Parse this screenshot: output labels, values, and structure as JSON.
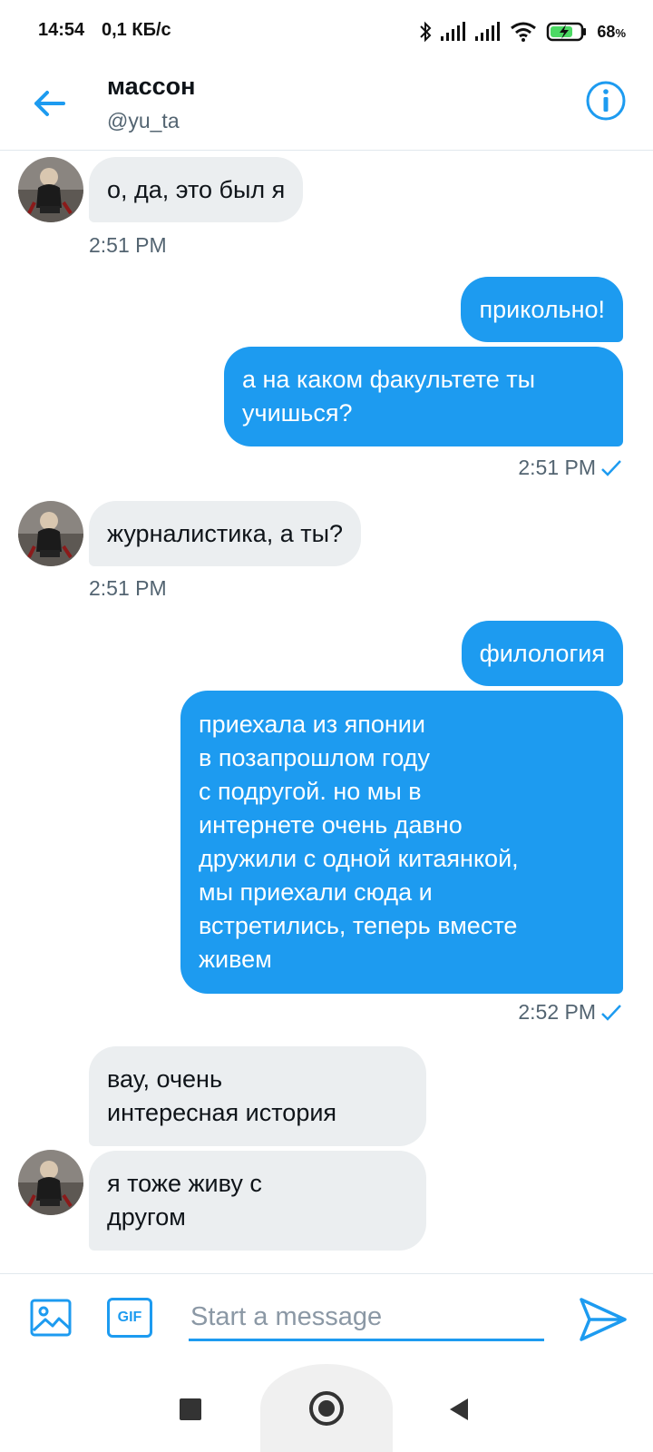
{
  "status_bar": {
    "time": "14:54",
    "speed": "0,1 КБ/с",
    "battery": "68",
    "battery_unit": "%",
    "icons": [
      "bluetooth-icon",
      "signal-icon",
      "signal-icon",
      "wifi-icon",
      "battery-charging-icon"
    ]
  },
  "header": {
    "title": "массон",
    "handle": "@yu_ta"
  },
  "messages": [
    {
      "direction": "received",
      "text": "о, да, это был я",
      "time": "2:51 PM"
    },
    {
      "direction": "sent",
      "text": "прикольно!"
    },
    {
      "direction": "sent",
      "text": "а на каком факультете ты\nучишься?",
      "time": "2:51 PM"
    },
    {
      "direction": "received",
      "text": "журналистика, а ты?",
      "time": "2:51 PM"
    },
    {
      "direction": "sent",
      "text": "филология"
    },
    {
      "direction": "sent",
      "text": "приехала из японии\nв позапрошлом году\nс подругой. но мы в\nинтернете очень давно\nдружили с одной китаянкой,\nмы приехали сюда и\nвстретились, теперь вместе\nживем",
      "time": "2:52 PM"
    },
    {
      "direction": "received",
      "text": "вау, очень\nинтересная история"
    },
    {
      "direction": "received",
      "text": "я тоже живу с\nдругом"
    }
  ],
  "composer": {
    "placeholder": "Start a message",
    "gif_label": "GIF"
  },
  "colors": {
    "accent": "#1d9bf0",
    "received_bubble": "#ebeef0",
    "secondary_text": "#536471"
  }
}
